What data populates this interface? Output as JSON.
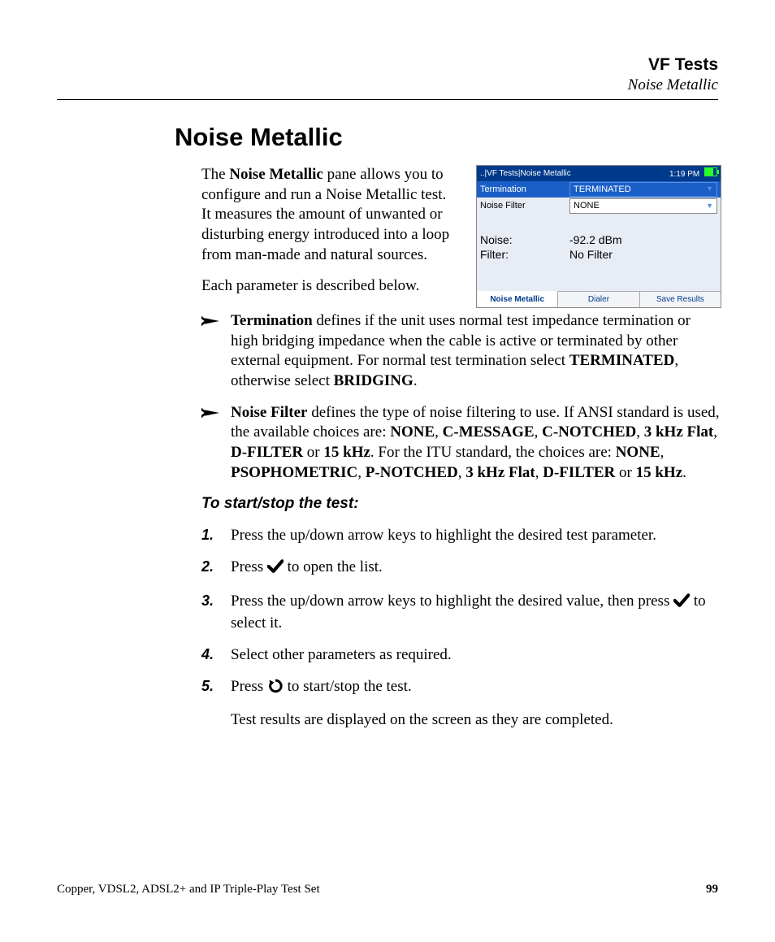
{
  "header": {
    "title": "VF Tests",
    "subtitle": "Noise Metallic"
  },
  "section_title": "Noise Metallic",
  "intro": {
    "p1_pre": "The ",
    "p1_bold": "Noise Metallic",
    "p1_post": " pane allows you to configure and run a Noise Metallic test. It measures the amount of unwanted or disturbing energy introduced into a loop from man-made and natural sources.",
    "p2": "Each parameter is described below."
  },
  "screenshot": {
    "breadcrumb": "..|VF Tests|Noise Metallic",
    "time": "1:19 PM",
    "rows": [
      {
        "label": "Termination",
        "value": "TERMINATED",
        "selected": true
      },
      {
        "label": "Noise Filter",
        "value": "NONE",
        "selected": false
      }
    ],
    "results": [
      {
        "label": "Noise:",
        "value": "-92.2 dBm"
      },
      {
        "label": "Filter:",
        "value": "No Filter"
      }
    ],
    "tabs": [
      {
        "label": "Noise Metallic",
        "active": true
      },
      {
        "label": "Dialer",
        "active": false
      },
      {
        "label": "Save Results",
        "active": false
      }
    ]
  },
  "bullets": {
    "b1": {
      "lead": "Termination",
      "rest": " defines if the unit uses normal test impedance termination or high bridging impedance when the cable is active or terminated by other external equipment. For normal test termination select ",
      "kw1": "TERMINATED",
      "mid": ", otherwise select ",
      "kw2": "BRIDGING",
      "end": "."
    },
    "b2": {
      "lead": "Noise Filter",
      "rest1": " defines the type of noise filtering to use. If ANSI standard is used, the available choices are: ",
      "kw": [
        "NONE",
        "C-MESSAGE",
        "C-NOTCHED",
        "3 kHz Flat",
        "D-FILTER",
        "15 kHz"
      ],
      "mid": ". For the ITU standard, the choices are: ",
      "kw2": [
        "NONE",
        "PSOPHOMETRIC",
        "P-NOTCHED",
        "3 kHz Flat",
        "D-FILTER",
        "15 kHz"
      ],
      "end": "."
    }
  },
  "subhead": "To start/stop the test:",
  "steps": {
    "s1": "Press the up/down arrow keys to highlight the desired test parameter.",
    "s2_pre": "Press ",
    "s2_post": " to open the list.",
    "s3_pre": "Press the up/down arrow keys to highlight the desired value, then press ",
    "s3_post": " to select it.",
    "s4": "Select other parameters as required.",
    "s5_pre": "Press ",
    "s5_post": " to start/stop the test.",
    "after": "Test results are displayed on the screen as they are completed."
  },
  "footer": {
    "left": "Copper, VDSL2, ADSL2+ and IP Triple-Play Test Set",
    "page": "99"
  }
}
